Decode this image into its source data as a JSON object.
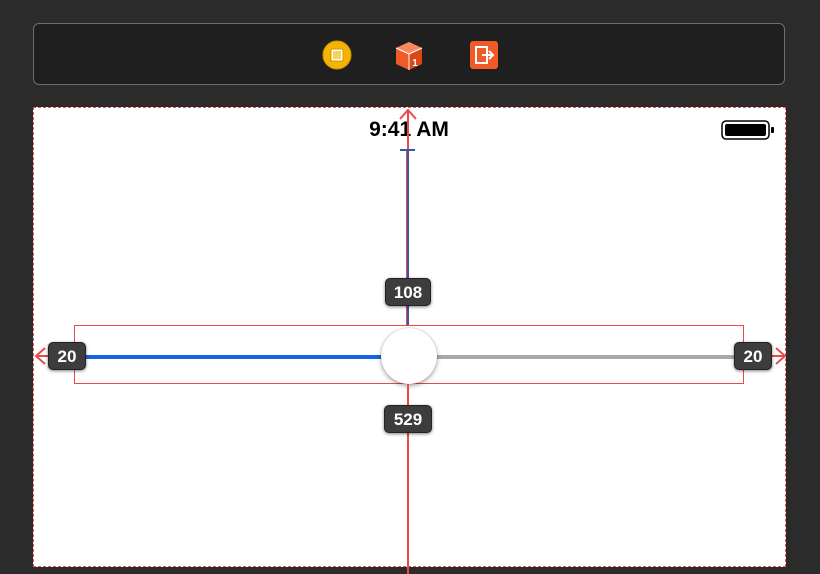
{
  "dock": {
    "icons": [
      {
        "name": "view-controller-icon",
        "color": "#f5b400"
      },
      {
        "name": "first-responder-icon",
        "color": "#f05a28"
      },
      {
        "name": "exit-icon",
        "color": "#f05a28"
      }
    ]
  },
  "status_bar": {
    "time": "9:41 AM",
    "battery": "battery-full-icon"
  },
  "constraints": {
    "top": "108",
    "bottom": "529",
    "leading": "20",
    "trailing": "20"
  },
  "slider": {
    "value": 0.5,
    "min_track_color": "#1565e0",
    "max_track_color": "#a9a9a9"
  },
  "colors": {
    "constraint_red": "#e94b4b",
    "constraint_blue": "#3a55a5",
    "canvas_background": "#ffffff",
    "editor_background": "#2b2b2b"
  }
}
